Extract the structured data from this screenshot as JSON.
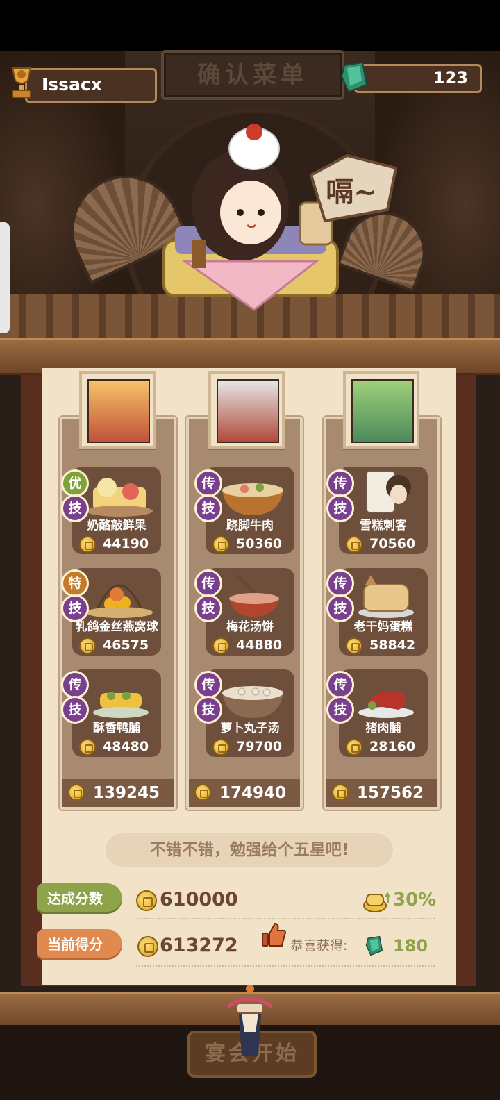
{
  "header": {
    "title": "确认菜单"
  },
  "player": {
    "name": "Issacx"
  },
  "currency": {
    "gems": "123"
  },
  "character": {
    "speech": "嗝~"
  },
  "columns": [
    {
      "total": "139245",
      "dishes": [
        {
          "name": "奶酪敲鲜果",
          "price": "44190",
          "badges": [
            "优",
            "技"
          ]
        },
        {
          "name": "乳鸽金丝燕窝球",
          "price": "46575",
          "badges": [
            "特",
            "技"
          ]
        },
        {
          "name": "酥香鸭脯",
          "price": "48480",
          "badges": [
            "传",
            "技"
          ]
        }
      ]
    },
    {
      "total": "174940",
      "dishes": [
        {
          "name": "跷脚牛肉",
          "price": "50360",
          "badges": [
            "传",
            "技"
          ]
        },
        {
          "name": "梅花汤饼",
          "price": "44880",
          "badges": [
            "传",
            "技"
          ]
        },
        {
          "name": "萝卜丸子汤",
          "price": "79700",
          "badges": [
            "传",
            "技"
          ]
        }
      ]
    },
    {
      "total": "157562",
      "dishes": [
        {
          "name": "雪糕刺客",
          "price": "70560",
          "badges": [
            "传",
            "技"
          ]
        },
        {
          "name": "老干妈蛋糕",
          "price": "58842",
          "badges": [
            "传",
            "技"
          ]
        },
        {
          "name": "猪肉脯",
          "price": "28160",
          "badges": [
            "传",
            "技"
          ]
        }
      ]
    }
  ],
  "comment": "不错不错，勉强给个五星吧!",
  "target": {
    "label": "达成分数",
    "score": "610000",
    "bonus": "30%"
  },
  "current": {
    "label": "当前得分",
    "score": "613272",
    "reward_label": "恭喜获得:",
    "reward_value": "180"
  },
  "start_button": "宴会开始",
  "colors": {
    "accent_green": "#8ea34a",
    "accent_orange": "#e08a50",
    "badge_purple": "#7a3f8e"
  }
}
